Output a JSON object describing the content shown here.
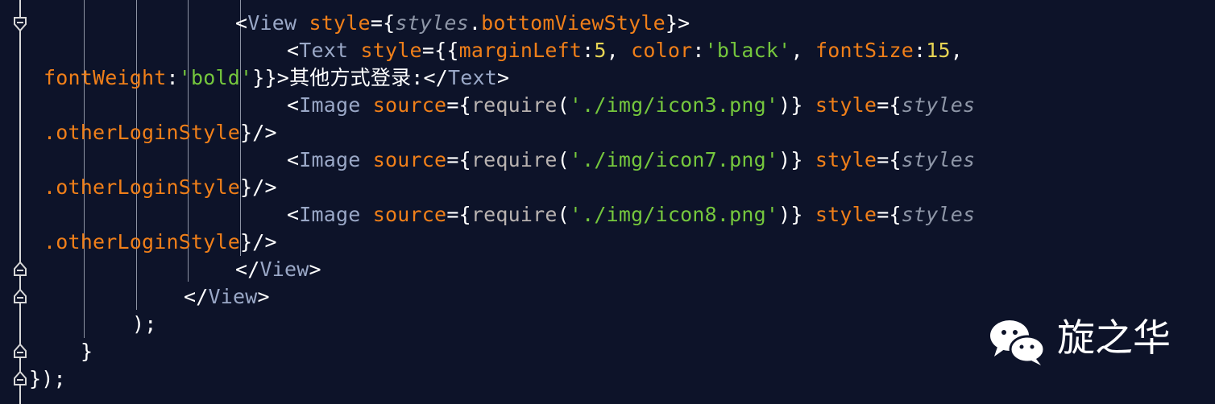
{
  "code": {
    "line1": {
      "indent": "",
      "tag": "View",
      "attr": "style",
      "style_obj": "styles",
      "style_prop": "bottomViewStyle"
    },
    "line2": {
      "tag": "Text",
      "attr": "style",
      "margin_key": "marginLeft",
      "margin_val": "5",
      "color_key": "color",
      "color_val": "'black'",
      "font_key": "fontSize",
      "font_val": "15"
    },
    "line3": {
      "font_weight_key": "fontWeight",
      "font_weight_val": "'bold'",
      "text": "其他方式登录:",
      "close_tag": "Text"
    },
    "line4": {
      "tag": "Image",
      "attr": "source",
      "fn": "require",
      "path": "'./img/icon3.png'",
      "style_attr": "style",
      "style_obj": "styles"
    },
    "line5": {
      "prop": ".otherLoginStyle"
    },
    "line6": {
      "tag": "Image",
      "attr": "source",
      "fn": "require",
      "path": "'./img/icon7.png'",
      "style_attr": "style",
      "style_obj": "styles"
    },
    "line7": {
      "prop": ".otherLoginStyle"
    },
    "line8": {
      "tag": "Image",
      "attr": "source",
      "fn": "require",
      "path": "'./img/icon8.png'",
      "style_attr": "style",
      "style_obj": "styles"
    },
    "line9": {
      "prop": ".otherLoginStyle"
    },
    "line10": {
      "close_tag": "View"
    },
    "line11": {
      "close_tag": "View"
    },
    "line12": {
      "text": ");"
    },
    "line13": {
      "text": "}"
    },
    "line14": {
      "text": "});"
    }
  },
  "watermark": {
    "text": "旋之华",
    "icon": "wechat-icon"
  },
  "colors": {
    "background": "#0d1329",
    "tag": "#9aa8c7",
    "attribute": "#f07f19",
    "string": "#75c73d",
    "number": "#e6d454",
    "italic": "#8e96a7"
  }
}
